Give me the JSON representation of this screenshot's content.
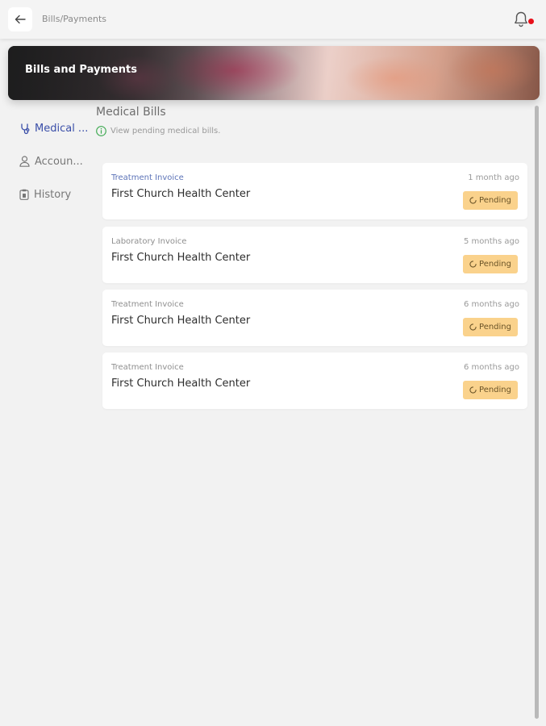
{
  "header": {
    "breadcrumb": "Bills/Payments",
    "back_icon": "arrow-left-icon",
    "notification_icon": "bell-icon",
    "notification_dot_color": "#e8101a"
  },
  "banner": {
    "title": "Bills and Payments"
  },
  "sidebar": {
    "items": [
      {
        "label": "Medical ...",
        "icon": "stethoscope-icon",
        "active": true
      },
      {
        "label": "Accoun...",
        "icon": "user-icon",
        "active": false
      },
      {
        "label": "History",
        "icon": "clipboard-icon",
        "active": false
      }
    ]
  },
  "section": {
    "title": "Medical Bills",
    "subtitle": "View pending medical bills."
  },
  "bills": [
    {
      "type": "Treatment Invoice",
      "provider": "First Church Health Center",
      "time": "1 month ago",
      "status": "Pending"
    },
    {
      "type": "Laboratory Invoice",
      "provider": "First Church Health Center",
      "time": "5 months ago",
      "status": "Pending"
    },
    {
      "type": "Treatment Invoice",
      "provider": "First Church Health Center",
      "time": "6 months ago",
      "status": "Pending"
    },
    {
      "type": "Treatment Invoice",
      "provider": "First Church Health Center",
      "time": "6 months ago",
      "status": "Pending"
    }
  ],
  "colors": {
    "accent": "#3a4ea8",
    "pending_badge": "#fad28c",
    "info_icon": "#3aa84e"
  }
}
